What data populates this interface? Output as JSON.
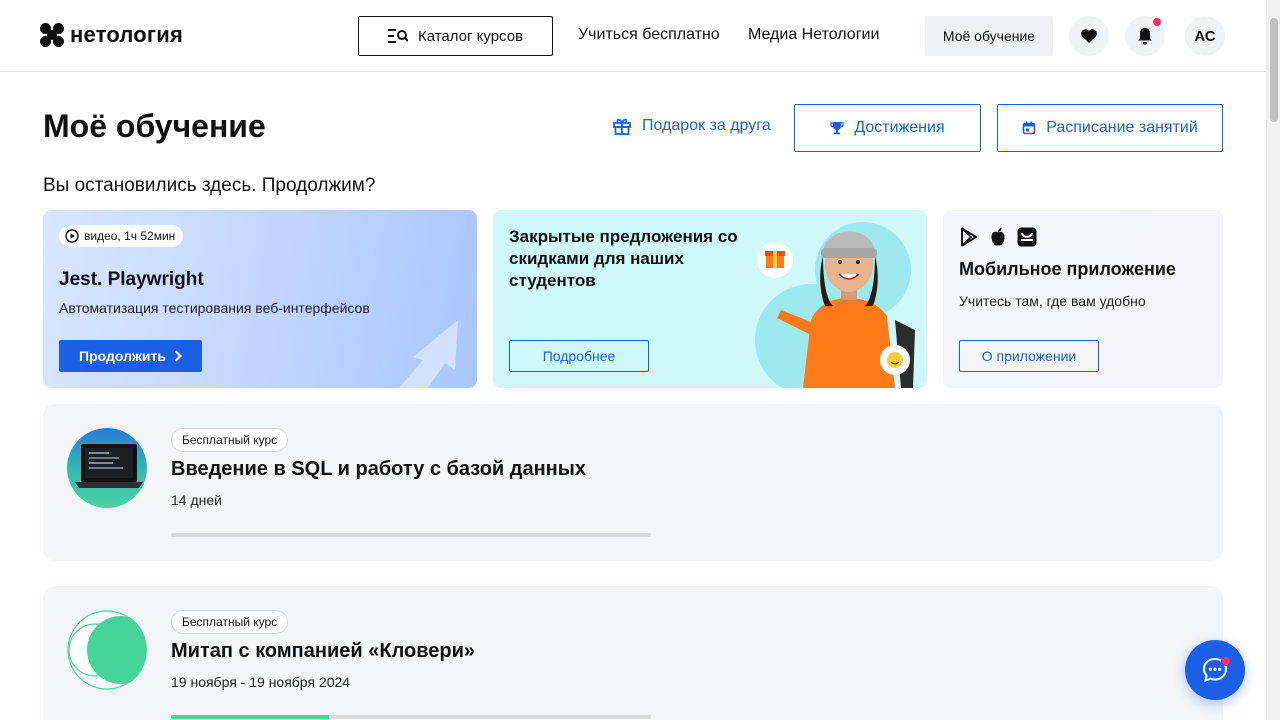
{
  "header": {
    "logo_text": "нетология",
    "catalog_label": "Каталог курсов",
    "nav": [
      "Учиться бесплатно",
      "Медиа Нетологии"
    ],
    "my_learning_label": "Моё обучение",
    "avatar_initials": "АС",
    "icons": {
      "catalog": "search-list-icon",
      "favorites": "heart-icon",
      "notifications": "bell-icon"
    }
  },
  "page": {
    "title": "Моё обучение",
    "gift_link": "Подарок за друга",
    "achievements_label": "Достижения",
    "schedule_label": "Расписание занятий",
    "continue_heading": "Вы остановились здесь. Продолжим?"
  },
  "cards": {
    "video": {
      "badge": "видео, 1ч 52мин",
      "title": "Jest. Playwright",
      "subtitle": "Автоматизация тестирования веб-интерфейсов",
      "button": "Продолжить"
    },
    "promo": {
      "title": "Закрытые предложения со скидками для наших студентов",
      "button": "Подробнее"
    },
    "app": {
      "title": "Мобильное приложение",
      "subtitle": "Учитесь там, где вам удобно",
      "button": "О приложении",
      "icons": [
        "google-play-icon",
        "apple-icon",
        "huawei-appgallery-icon"
      ]
    }
  },
  "courses": [
    {
      "badge": "Бесплатный курс",
      "title": "Введение в SQL и работу с базой данных",
      "meta": "14 дней",
      "progress": 0
    },
    {
      "badge": "Бесплатный курс",
      "title": "Митап с компанией «Кловери»",
      "meta": "19 ноября - 19 ноября 2024",
      "progress": 0.33
    }
  ],
  "colors": {
    "accent": "#1a5fe6",
    "notification": "#ff2d6a",
    "progress": "#46d39a",
    "card_bg": "#f4f5f7"
  }
}
